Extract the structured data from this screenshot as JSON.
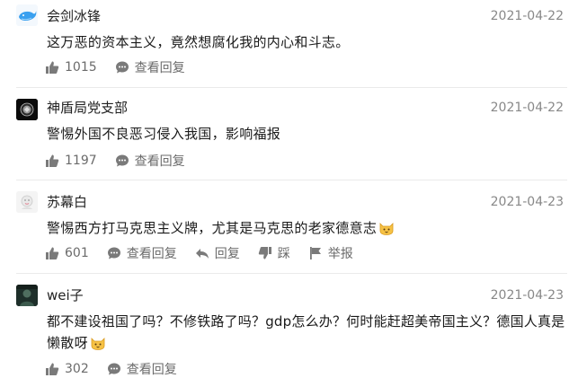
{
  "comments": [
    {
      "username": "会剑冰锋",
      "date": "2021-04-22",
      "text": "这万恶的资本主义，竟然想腐化我的内心和斗志。",
      "likes": "1015",
      "view_replies": "查看回复"
    },
    {
      "username": "神盾局党支部",
      "date": "2021-04-22",
      "text": "警惕外国不良恶习侵入我国，影响福报",
      "likes": "1197",
      "view_replies": "查看回复"
    },
    {
      "username": "苏幕白",
      "date": "2021-04-23",
      "text": "警惕西方打马克思主义牌，尤其是马克思的老家德意志",
      "likes": "601",
      "view_replies": "查看回复",
      "reply": "回复",
      "dislike": "踩",
      "report": "举报"
    },
    {
      "username": "wei子",
      "date": "2021-04-23",
      "text_line1": "都不建设祖国了吗？不修铁路了吗？gdp怎么办？何时能赶超美帝国主义？德国人真是",
      "text_line2": "懒散呀",
      "likes": "302",
      "view_replies": "查看回复"
    }
  ],
  "colors": {
    "text": "#1a1a1a",
    "meta": "#888888",
    "action": "#6b6b6b",
    "divider": "#eaeaea"
  }
}
